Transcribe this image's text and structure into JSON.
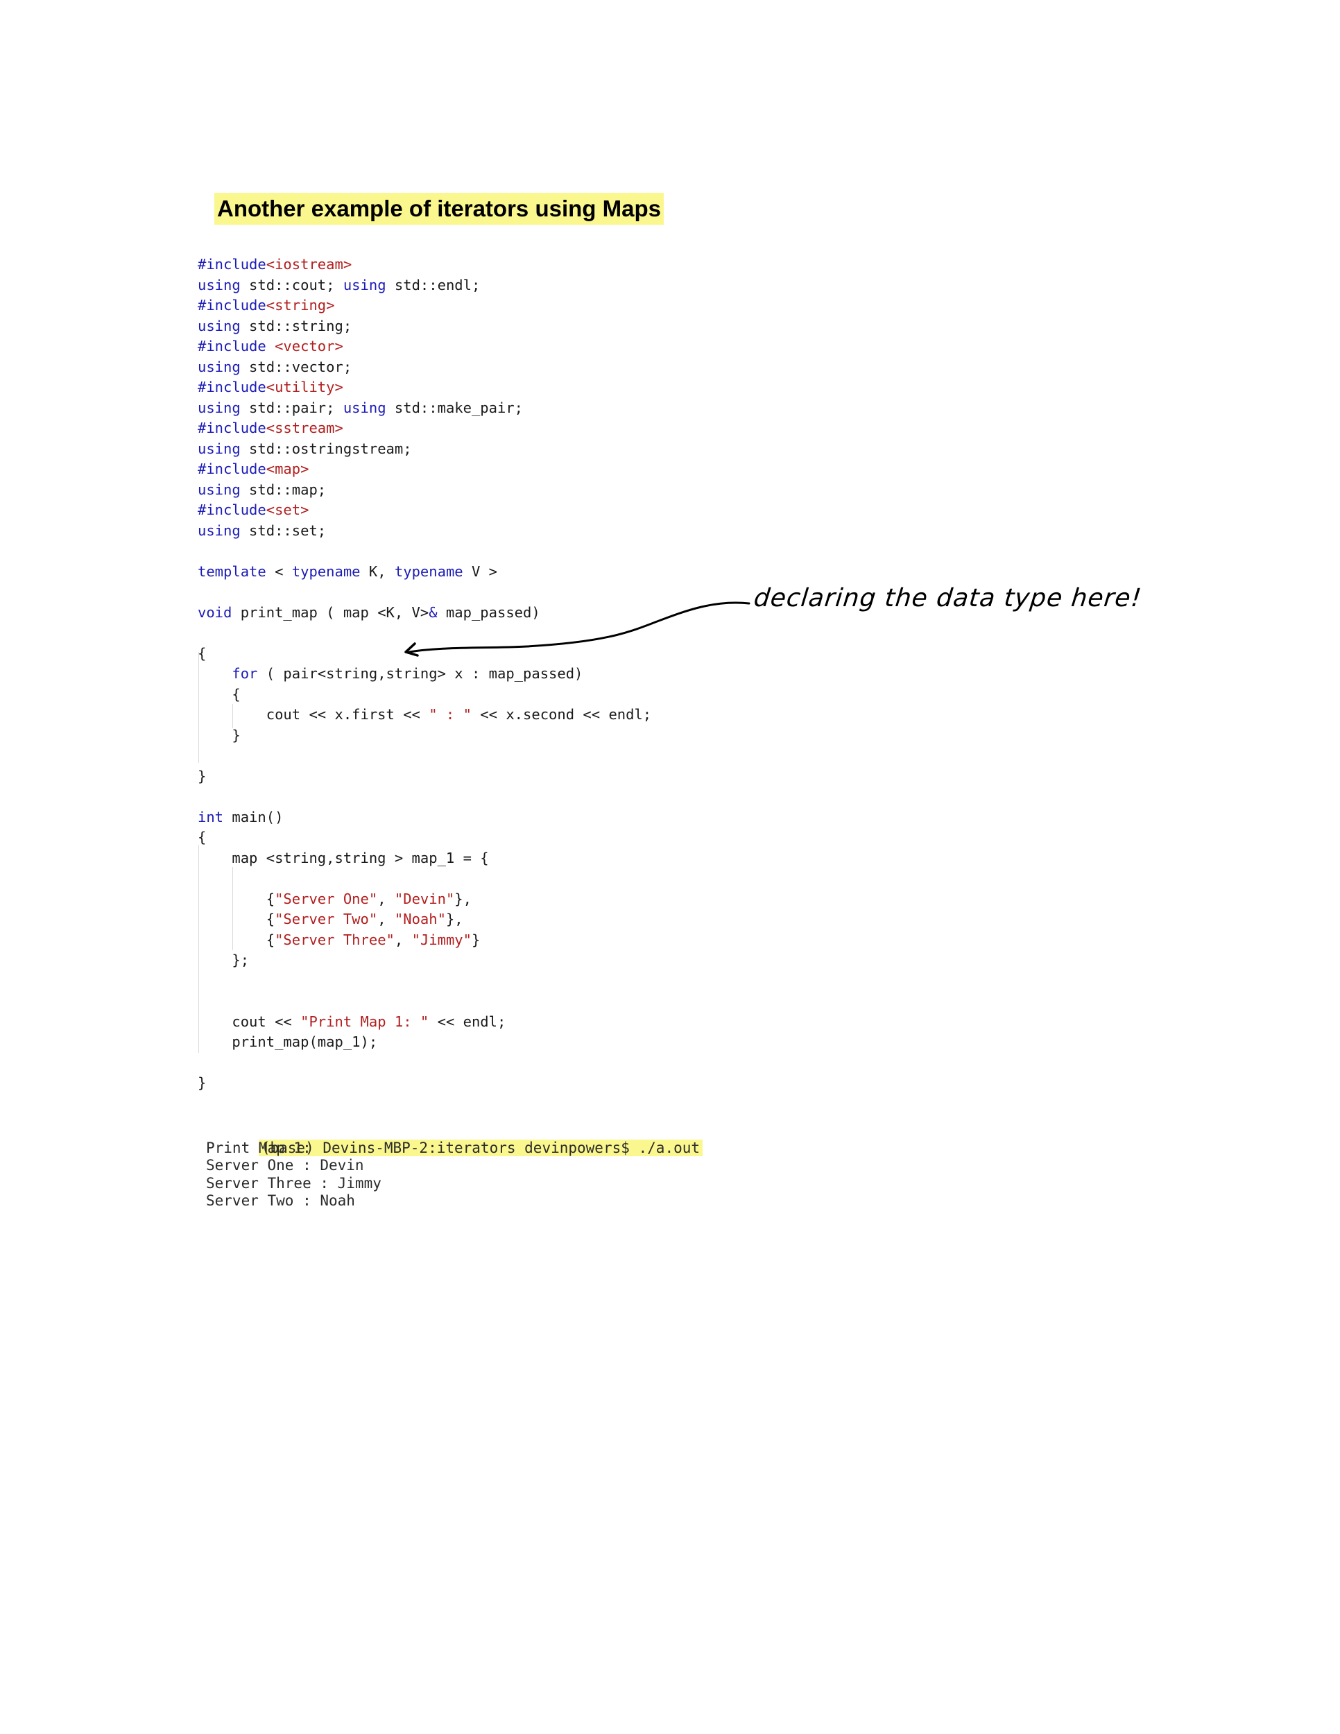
{
  "title": "Another example of iterators using Maps",
  "code_lines": [
    [
      {
        "t": "#include",
        "c": "kw"
      },
      {
        "t": "<iostream>",
        "c": "str"
      }
    ],
    [
      {
        "t": "using",
        "c": "kw"
      },
      {
        "t": " std::cout; ",
        "c": "plain"
      },
      {
        "t": "using",
        "c": "kw"
      },
      {
        "t": " std::endl;",
        "c": "plain"
      }
    ],
    [
      {
        "t": "#include",
        "c": "kw"
      },
      {
        "t": "<string>",
        "c": "str"
      }
    ],
    [
      {
        "t": "using",
        "c": "kw"
      },
      {
        "t": " std::string;",
        "c": "plain"
      }
    ],
    [
      {
        "t": "#include ",
        "c": "kw"
      },
      {
        "t": "<vector>",
        "c": "str"
      }
    ],
    [
      {
        "t": "using",
        "c": "kw"
      },
      {
        "t": " std::vector;",
        "c": "plain"
      }
    ],
    [
      {
        "t": "#include",
        "c": "kw"
      },
      {
        "t": "<utility>",
        "c": "str"
      }
    ],
    [
      {
        "t": "using",
        "c": "kw"
      },
      {
        "t": " std::pair; ",
        "c": "plain"
      },
      {
        "t": "using",
        "c": "kw"
      },
      {
        "t": " std::make_pair;",
        "c": "plain"
      }
    ],
    [
      {
        "t": "#include",
        "c": "kw"
      },
      {
        "t": "<sstream>",
        "c": "str"
      }
    ],
    [
      {
        "t": "using",
        "c": "kw"
      },
      {
        "t": " std::ostringstream;",
        "c": "plain"
      }
    ],
    [
      {
        "t": "#include",
        "c": "kw"
      },
      {
        "t": "<map>",
        "c": "str"
      }
    ],
    [
      {
        "t": "using",
        "c": "kw"
      },
      {
        "t": " std::map;",
        "c": "plain"
      }
    ],
    [
      {
        "t": "#include",
        "c": "kw"
      },
      {
        "t": "<set>",
        "c": "str"
      }
    ],
    [
      {
        "t": "using",
        "c": "kw"
      },
      {
        "t": " std::set;",
        "c": "plain"
      }
    ],
    [],
    [
      {
        "t": "template",
        "c": "kw"
      },
      {
        "t": " < ",
        "c": "plain"
      },
      {
        "t": "typename",
        "c": "kw"
      },
      {
        "t": " K, ",
        "c": "plain"
      },
      {
        "t": "typename",
        "c": "kw"
      },
      {
        "t": " V >",
        "c": "plain"
      }
    ],
    [],
    [
      {
        "t": "void",
        "c": "kw"
      },
      {
        "t": " print_map ( map <K, V>",
        "c": "plain"
      },
      {
        "t": "&",
        "c": "kw"
      },
      {
        "t": " map_passed)",
        "c": "plain"
      }
    ],
    [],
    [
      {
        "t": "{",
        "c": "plain"
      }
    ],
    [
      {
        "t": "    ",
        "c": "plain"
      },
      {
        "t": "for",
        "c": "kw"
      },
      {
        "t": " ( pair<string,string> x : map_passed)",
        "c": "plain"
      }
    ],
    [
      {
        "t": "    {",
        "c": "plain"
      }
    ],
    [
      {
        "t": "        cout << x.first << ",
        "c": "plain"
      },
      {
        "t": "\" : \"",
        "c": "str"
      },
      {
        "t": " << x.second << endl;",
        "c": "plain"
      }
    ],
    [
      {
        "t": "    }",
        "c": "plain"
      }
    ],
    [],
    [
      {
        "t": "}",
        "c": "plain"
      }
    ],
    [],
    [
      {
        "t": "int",
        "c": "kw"
      },
      {
        "t": " main()",
        "c": "plain"
      }
    ],
    [
      {
        "t": "{",
        "c": "plain"
      }
    ],
    [
      {
        "t": "    map <string,string > map_1 = {",
        "c": "plain"
      }
    ],
    [],
    [
      {
        "t": "        {",
        "c": "plain"
      },
      {
        "t": "\"Server One\"",
        "c": "str"
      },
      {
        "t": ", ",
        "c": "plain"
      },
      {
        "t": "\"Devin\"",
        "c": "str"
      },
      {
        "t": "},",
        "c": "plain"
      }
    ],
    [
      {
        "t": "        {",
        "c": "plain"
      },
      {
        "t": "\"Server Two\"",
        "c": "str"
      },
      {
        "t": ", ",
        "c": "plain"
      },
      {
        "t": "\"Noah\"",
        "c": "str"
      },
      {
        "t": "},",
        "c": "plain"
      }
    ],
    [
      {
        "t": "        {",
        "c": "plain"
      },
      {
        "t": "\"Server Three\"",
        "c": "str"
      },
      {
        "t": ", ",
        "c": "plain"
      },
      {
        "t": "\"Jimmy\"",
        "c": "str"
      },
      {
        "t": "}",
        "c": "plain"
      }
    ],
    [
      {
        "t": "    };",
        "c": "plain"
      }
    ],
    [],
    [],
    [
      {
        "t": "    cout << ",
        "c": "plain"
      },
      {
        "t": "\"Print Map 1: \"",
        "c": "str"
      },
      {
        "t": " << endl;",
        "c": "plain"
      }
    ],
    [
      {
        "t": "    print_map(map_1);",
        "c": "plain"
      }
    ],
    [],
    [
      {
        "t": "}",
        "c": "plain"
      }
    ]
  ],
  "annotation": "declaring the data type here!",
  "terminal": {
    "prompt": "(base) Devins-MBP-2:iterators devinpowers$ ./a.out",
    "output": [
      "Print Map 1:",
      "Server One : Devin",
      "Server Three : Jimmy",
      "Server Two : Noah"
    ]
  },
  "colors": {
    "highlight": "#fbf78f",
    "keyword": "#1b1bb8",
    "string": "#b21f1f"
  }
}
